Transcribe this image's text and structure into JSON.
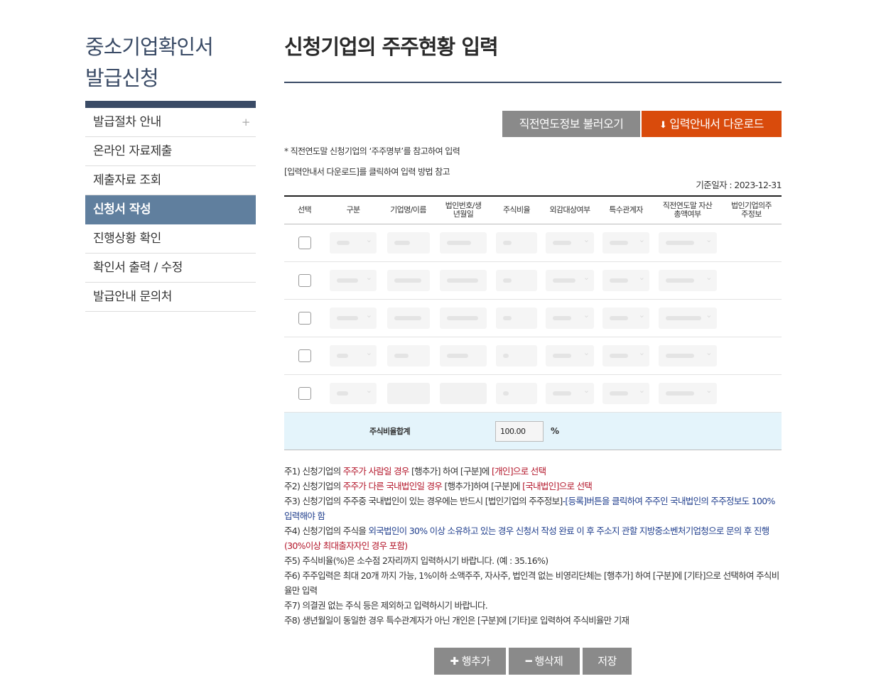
{
  "sidebar": {
    "title_line1": "중소기업확인서",
    "title_line2": "발급신청",
    "items": [
      {
        "label": "발급절차 안내",
        "active": false,
        "expand": "+"
      },
      {
        "label": "온라인 자료제출",
        "active": false
      },
      {
        "label": "제출자료 조회",
        "active": false
      },
      {
        "label": "신청서 작성",
        "active": true
      },
      {
        "label": "진행상황 확인",
        "active": false
      },
      {
        "label": "확인서 출력 / 수정",
        "active": false
      },
      {
        "label": "발급안내 문의처",
        "active": false
      }
    ]
  },
  "main": {
    "title": "신청기업의 주주현황 입력",
    "buttons": {
      "load_prev": "직전연도정보 불러오기",
      "download_guide": "입력안내서 다운로드"
    },
    "notes_top": [
      "* 직전연도말 신청기업의 ‘주주명부’를 참고하여 입력",
      "[입력안내서 다운로드]를 클릭하여 입력 방법 참고"
    ],
    "base_date": "기준일자 : 2023-12-31"
  },
  "table": {
    "headers": [
      "선택",
      "구분",
      "기업명/이름",
      "법인번호/생년월일",
      "주식비율",
      "외감대상여부",
      "특수관계자",
      "직전연도말 자산총액여부",
      "법인기업의주주정보"
    ],
    "row_count": 5,
    "sum_label": "주식비율합계",
    "sum_value": "100.00",
    "sum_unit": "%"
  },
  "footnotes": {
    "n1": {
      "p1": "주1) 신청기업의 ",
      "r1": "주주가 사람일 경우",
      "p2": " [행추가] 하여 [구분]에 ",
      "r2": "[개인]으로 선택"
    },
    "n2": {
      "p1": "주2) 신청기업의 ",
      "r1": "주주가 다른 국내법인일 경우",
      "p2": " [행추가]하여 [구분]에 ",
      "r2": "[국내법인]으로 선택"
    },
    "n3": {
      "p1": "주3) 신청기업의 주주중 국내법인이 있는 경우에는 반드시 [법인기업의 주주정보]",
      "b1": "-[등록]버튼을 클릭하여 주주인 국내법인의 주주정보도 100% 입력해야 함"
    },
    "n4": {
      "p1": "주4) 신청기업의 주식을 ",
      "b1": "외국법인이 30% 이상 소유하고 있는 경우 신청서 작성 완료 이 후 주소지 관할 지방중소벤처기업청으로 문의 후 진행",
      "r1": "(30%이상 최대출자자인 경우 포함)"
    },
    "n5": "주5) 주식비율(%)은 소수점 2자리까지 입력하시기 바랍니다. (예 : 35.16%)",
    "n6": "주6) 주주입력은 최대 20개 까지 가능, 1%이하 소액주주, 자사주, 법인격 없는 비영리단체는 [행추가] 하여 [구분]에 [기타]으로 선택하여 주식비율만 입력",
    "n7": "주7) 의결권 없는 주식 등은 제외하고 입력하시기 바랍니다.",
    "n8": "주8) 생년월일이 동일한 경우 특수관계자가 아닌 개인은 [구분]에 [기타]로 입력하여 주식비율만 기재"
  },
  "bottom": {
    "add_row": "행추가",
    "delete_row": "행삭제",
    "save": "저장"
  },
  "colors": {
    "navy": "#3a4b66",
    "active_menu": "#607f9e",
    "orange": "#d94b0c",
    "gray_button": "#8a8a8a",
    "sum_row_bg": "#e4f4fb"
  }
}
